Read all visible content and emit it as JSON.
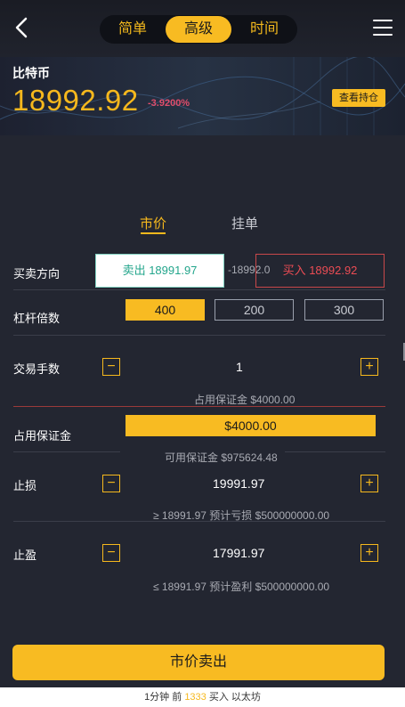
{
  "mode_tabs": [
    "简单",
    "高级",
    "时间"
  ],
  "active_mode": "高级",
  "coin": {
    "name": "比特币",
    "price": "18992.92",
    "change": "-3.9200%",
    "holding_button": "查看持仓"
  },
  "order_tabs": [
    "市价",
    "挂单"
  ],
  "direction": {
    "label": "买卖方向",
    "sell": "卖出 18991.97",
    "spread": "-18992.0",
    "buy": "买入 18992.92"
  },
  "leverage": {
    "label": "杠杆倍数",
    "options": [
      "400",
      "200",
      "300"
    ],
    "selected": "400"
  },
  "lots": {
    "label": "交易手数",
    "value": "1",
    "minus": "−",
    "plus": "+",
    "margin_hint": "占用保证金 $4000.00"
  },
  "margin": {
    "label": "占用保证金",
    "value": "$4000.00",
    "available": "可用保证金 $975624.48"
  },
  "stop_loss": {
    "label": "止损",
    "value": "19991.97",
    "hint": "≥ 18991.97 预计亏损 $500000000.00"
  },
  "take_profit": {
    "label": "止盈",
    "value": "17991.97",
    "hint": "≤ 18991.97 预计盈利 $500000000.00"
  },
  "submit_label": "市价卖出",
  "footer": {
    "prefix": "1分钟 前",
    "count": "1333",
    "suffix": "买入 以太坊"
  },
  "colors": {
    "accent": "#f8bb22",
    "background": "#232631",
    "sell": "#22a58b",
    "buy": "#ec4c54",
    "negative_change": "#e04d6b"
  }
}
